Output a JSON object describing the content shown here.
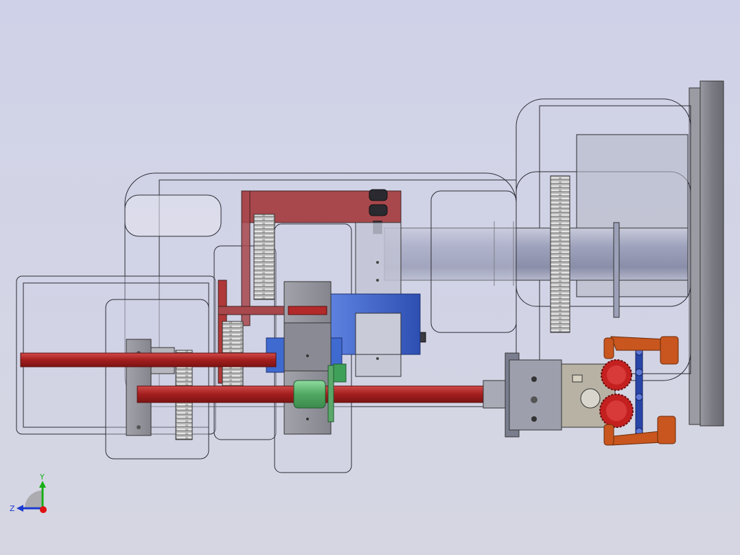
{
  "triad": {
    "y_axis_label": "Y",
    "z_axis_label": "Z"
  },
  "colors": {
    "background": "#d1d3e6",
    "housing_outline": "#2b2b33",
    "shaft_red": "#b22a2a",
    "bracket_red": "#a8484c",
    "bearing_blue": "#3b5fc4",
    "coupling_green": "#58b26a",
    "gear_gray": "#a9a9a9",
    "gripper_orange": "#c8561e",
    "gripper_gear_red": "#c42020",
    "link_blue": "#2845a8",
    "axis_x": "#e01010",
    "axis_y": "#16b016",
    "axis_z": "#1a3ad0"
  }
}
